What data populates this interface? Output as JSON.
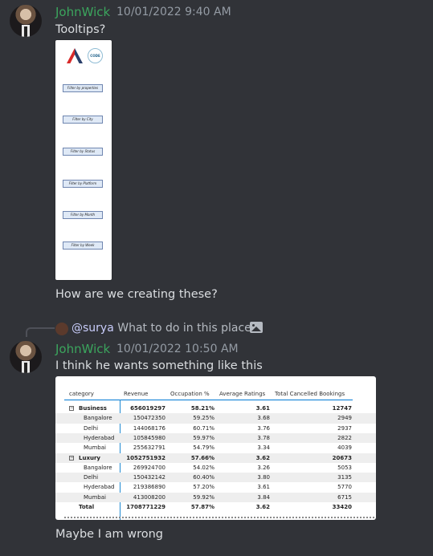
{
  "messages": [
    {
      "author": "JohnWick",
      "timestamp": "10/01/2022 9:40 AM",
      "text": "Tooltips?",
      "followup": "How are we creating these?"
    },
    {
      "reply": {
        "mention": "@surya",
        "text": "What to do in this place"
      },
      "author": "JohnWick",
      "timestamp": "10/01/2022 10:50 AM",
      "text": "I think he wants something like this",
      "followup": "Maybe I am wrong"
    }
  ],
  "attachment1": {
    "logo_text": "CODE",
    "filters": [
      "Filter by properties",
      "Filter by City",
      "Filter by Status",
      "Filter by Platform",
      "Filter by Month",
      "Filter by Week"
    ]
  },
  "attachment2": {
    "headers": [
      "category",
      "Revenue",
      "Occupation %",
      "Average Ratings",
      "Total Cancelled Bookings"
    ],
    "rows": [
      [
        "Business",
        "656019297",
        "58.21%",
        "3.61",
        "12747"
      ],
      [
        "Bangalore",
        "150472350",
        "59.25%",
        "3.68",
        "2949"
      ],
      [
        "Delhi",
        "144068176",
        "60.71%",
        "3.76",
        "2937"
      ],
      [
        "Hyderabad",
        "105845980",
        "59.97%",
        "3.78",
        "2822"
      ],
      [
        "Mumbai",
        "255632791",
        "54.79%",
        "3.34",
        "4039"
      ],
      [
        "Luxury",
        "1052751932",
        "57.66%",
        "3.62",
        "20673"
      ],
      [
        "Bangalore",
        "269924700",
        "54.02%",
        "3.26",
        "5053"
      ],
      [
        "Delhi",
        "150432142",
        "60.40%",
        "3.80",
        "3135"
      ],
      [
        "Hyderabad",
        "219386890",
        "57.20%",
        "3.61",
        "5770"
      ],
      [
        "Mumbai",
        "413008200",
        "59.92%",
        "3.84",
        "6715"
      ],
      [
        "Total",
        "1708771229",
        "57.87%",
        "3.62",
        "33420"
      ]
    ]
  },
  "colors": {
    "background": "#313338",
    "username": "#3ba55d",
    "timestamp": "#949ba4",
    "mention": "#c9cdfb"
  }
}
